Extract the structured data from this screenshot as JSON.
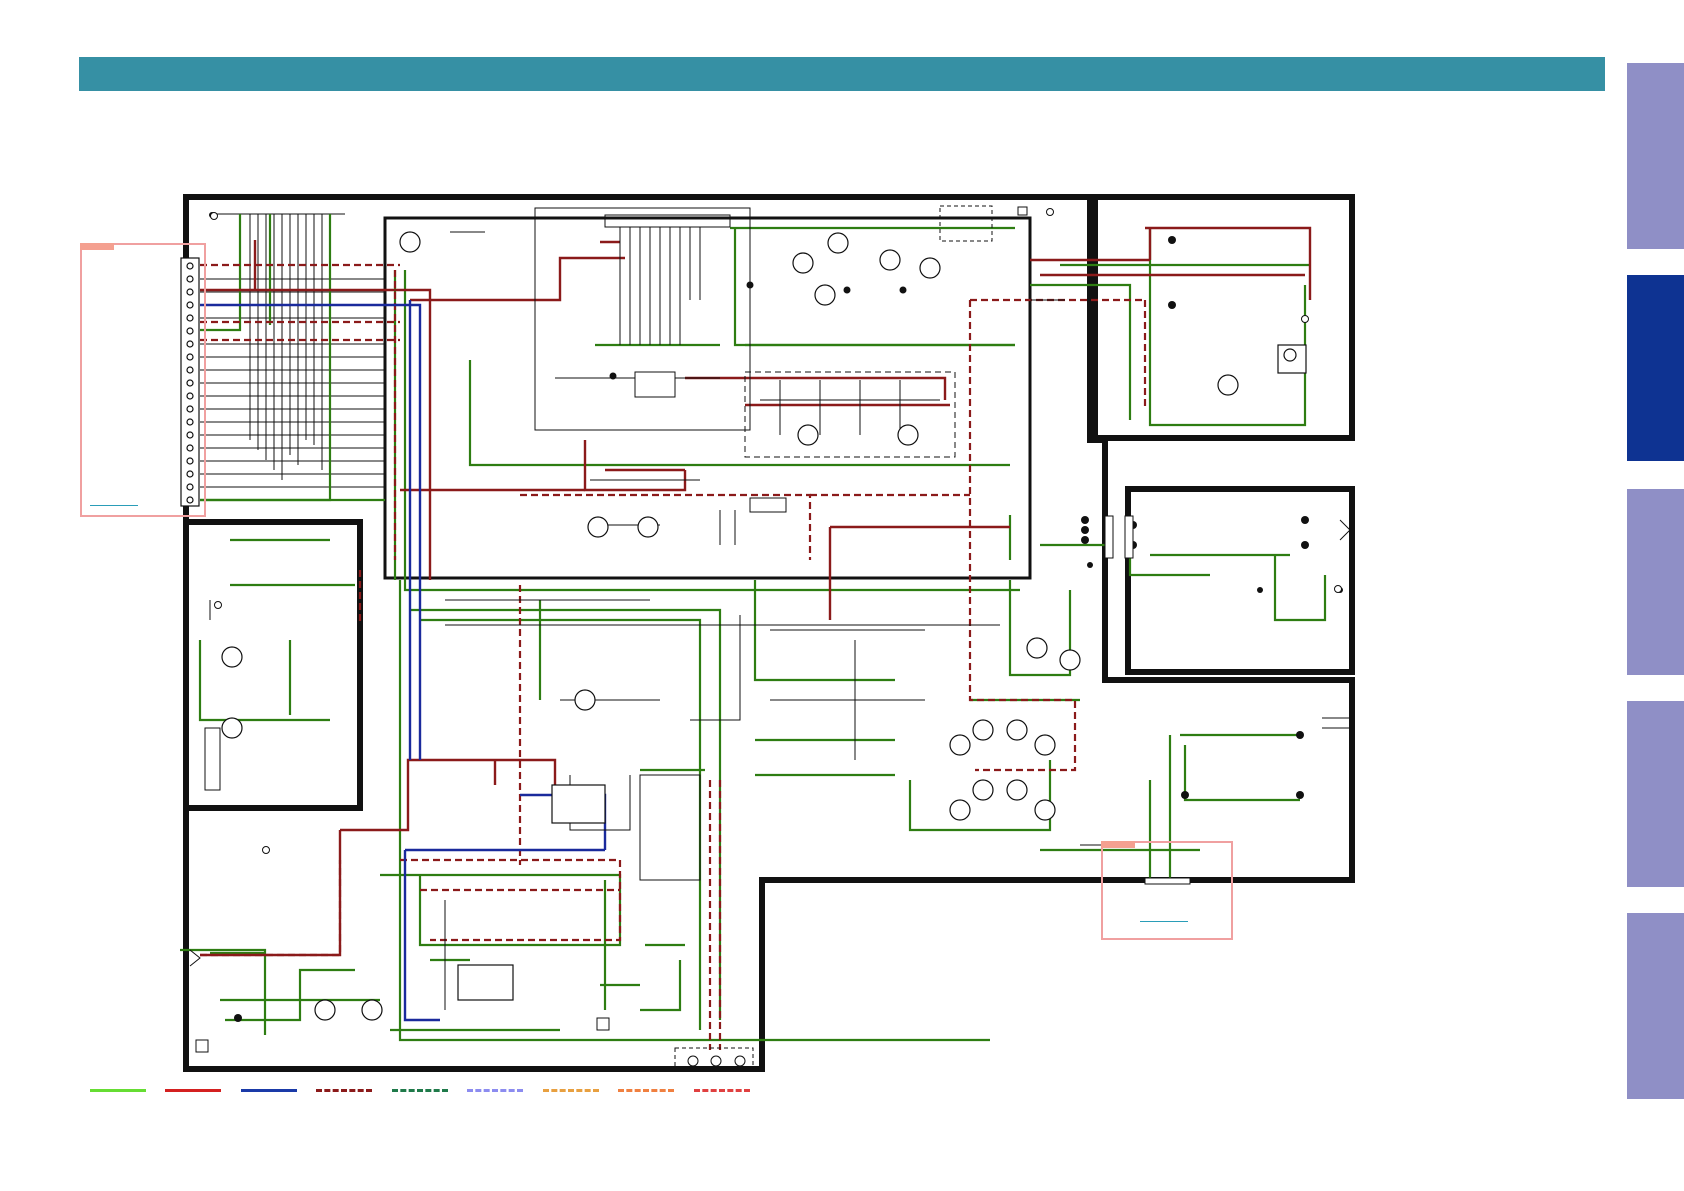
{
  "header": {
    "color": "#3690a4"
  },
  "side_tabs": [
    {
      "name": "tab-1",
      "active": false,
      "color": "#8f8fc6"
    },
    {
      "name": "tab-2",
      "active": true,
      "color": "#0e3392"
    },
    {
      "name": "tab-3",
      "active": false,
      "color": "#8f8fc6"
    },
    {
      "name": "tab-4",
      "active": false,
      "color": "#8f8fc6"
    },
    {
      "name": "tab-5",
      "active": false,
      "color": "#8f8fc6"
    }
  ],
  "wire_colors": {
    "green": "#2e7d12",
    "dark_red": "#8b1a1a",
    "blue": "#1a2a9c",
    "gray": "#888888",
    "black": "#111111"
  },
  "legend": [
    {
      "color": "#66dd33",
      "style": "solid"
    },
    {
      "color": "#d42020",
      "style": "solid"
    },
    {
      "color": "#1a3aa8",
      "style": "solid"
    },
    {
      "color": "#8b1a1a",
      "style": "dashed"
    },
    {
      "color": "#1f7a4a",
      "style": "dashed"
    },
    {
      "color": "#8c8cf0",
      "style": "dashed"
    },
    {
      "color": "#e8a040",
      "style": "dashed"
    },
    {
      "color": "#f08040",
      "style": "dashed"
    },
    {
      "color": "#e04040",
      "style": "dashed"
    }
  ]
}
